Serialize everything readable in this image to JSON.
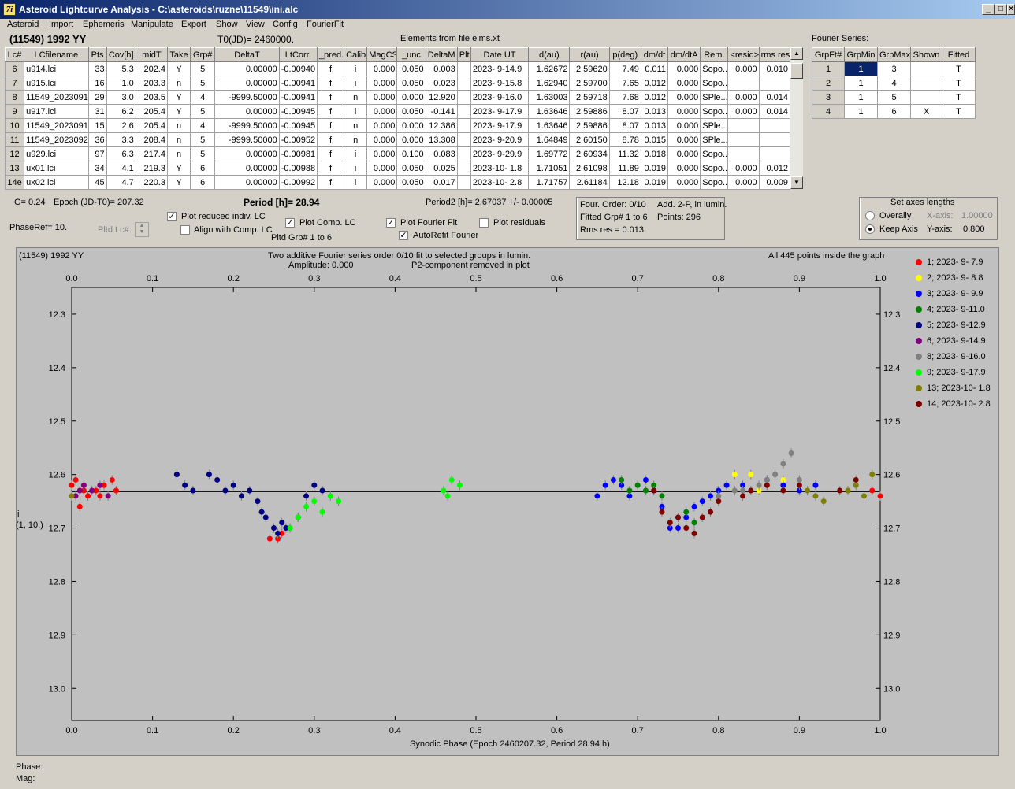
{
  "window": {
    "title": "Asteroid Lightcurve Analysis - C:\\asteroids\\ruzne\\11549\\ini.alc",
    "icon_text": "7i"
  },
  "menu": [
    "Asteroid",
    "Import",
    "Ephemeris",
    "Manipulate",
    "Export",
    "Show",
    "View",
    "Config",
    "FourierFit"
  ],
  "header": {
    "asteroid": "(11549) 1992 YY",
    "t0": "T0(JD)= 2460000.",
    "elements": "Elements from file elms.xt",
    "fourier_label": "Fourier Series:"
  },
  "lc_table": {
    "columns": [
      "Lc#",
      "LCfilename",
      "Pts",
      "Cov[h]",
      "midT",
      "Take",
      "Grp#",
      "DeltaT",
      "LtCorr.",
      "_pred.",
      "Calib.",
      "MagCS",
      "_unc",
      "DeltaM",
      "Plt",
      "Date UT",
      "d(au)",
      "r(au)",
      "p(deg)",
      "dm/dt",
      "dm/dtA",
      "Rem.",
      "<resid>",
      "rms res"
    ],
    "rows": [
      [
        "6",
        "u914.lci",
        "33",
        "5.3",
        "202.4",
        "Y",
        "5",
        "0.00000",
        "-0.00940",
        "f",
        "i",
        "0.000",
        "0.050",
        "0.003",
        "",
        "2023- 9-14.9",
        "1.62672",
        "2.59620",
        "7.49",
        "0.011",
        "0.000",
        "Sopo...",
        "0.000",
        "0.010"
      ],
      [
        "7",
        "u915.lci",
        "16",
        "1.0",
        "203.3",
        "n",
        "5",
        "0.00000",
        "-0.00941",
        "f",
        "i",
        "0.000",
        "0.050",
        "0.023",
        "",
        "2023- 9-15.8",
        "1.62940",
        "2.59700",
        "7.65",
        "0.012",
        "0.000",
        "Sopo...",
        "",
        ""
      ],
      [
        "8",
        "11549_2023091",
        "29",
        "3.0",
        "203.5",
        "Y",
        "4",
        "-9999.50000",
        "-0.00941",
        "f",
        "n",
        "0.000",
        "0.000",
        "12.920",
        "",
        "2023- 9-16.0",
        "1.63003",
        "2.59718",
        "7.68",
        "0.012",
        "0.000",
        "SPle...",
        "0.000",
        "0.014"
      ],
      [
        "9",
        "u917.lci",
        "31",
        "6.2",
        "205.4",
        "Y",
        "5",
        "0.00000",
        "-0.00945",
        "f",
        "i",
        "0.000",
        "0.050",
        "-0.141",
        "",
        "2023- 9-17.9",
        "1.63646",
        "2.59886",
        "8.07",
        "0.013",
        "0.000",
        "Sopo...",
        "0.000",
        "0.014"
      ],
      [
        "10",
        "11549_2023091",
        "15",
        "2.6",
        "205.4",
        "n",
        "4",
        "-9999.50000",
        "-0.00945",
        "f",
        "n",
        "0.000",
        "0.000",
        "12.386",
        "",
        "2023- 9-17.9",
        "1.63646",
        "2.59886",
        "8.07",
        "0.013",
        "0.000",
        "SPle...",
        "",
        ""
      ],
      [
        "11",
        "11549_2023092",
        "36",
        "3.3",
        "208.4",
        "n",
        "5",
        "-9999.50000",
        "-0.00952",
        "f",
        "n",
        "0.000",
        "0.000",
        "13.308",
        "",
        "2023- 9-20.9",
        "1.64849",
        "2.60150",
        "8.78",
        "0.015",
        "0.000",
        "SPle...",
        "",
        ""
      ],
      [
        "12",
        "u929.lci",
        "97",
        "6.3",
        "217.4",
        "n",
        "5",
        "0.00000",
        "-0.00981",
        "f",
        "i",
        "0.000",
        "0.100",
        "0.083",
        "",
        "2023- 9-29.9",
        "1.69772",
        "2.60934",
        "11.32",
        "0.018",
        "0.000",
        "Sopo...",
        "",
        ""
      ],
      [
        "13",
        "ux01.lci",
        "34",
        "4.1",
        "219.3",
        "Y",
        "6",
        "0.00000",
        "-0.00988",
        "f",
        "i",
        "0.000",
        "0.050",
        "0.025",
        "",
        "2023-10- 1.8",
        "1.71051",
        "2.61098",
        "11.89",
        "0.019",
        "0.000",
        "Sopo...",
        "0.000",
        "0.012"
      ],
      [
        "14e",
        "ux02.lci",
        "45",
        "4.7",
        "220.3",
        "Y",
        "6",
        "0.00000",
        "-0.00992",
        "f",
        "i",
        "0.000",
        "0.050",
        "0.017",
        "",
        "2023-10- 2.8",
        "1.71757",
        "2.61184",
        "12.18",
        "0.019",
        "0.000",
        "Sopo...",
        "0.000",
        "0.009"
      ]
    ]
  },
  "fourier_table": {
    "columns": [
      "GrpFt#",
      "GrpMin",
      "GrpMax",
      "Shown",
      "Fitted"
    ],
    "rows": [
      [
        "1",
        "1",
        "3",
        "",
        "T"
      ],
      [
        "2",
        "1",
        "4",
        "",
        "T"
      ],
      [
        "3",
        "1",
        "5",
        "",
        "T"
      ],
      [
        "4",
        "1",
        "6",
        "X",
        "T"
      ]
    ]
  },
  "params": {
    "g": "G= 0.24",
    "epoch": "Epoch (JD-T0)= 207.32",
    "period": "Period [h]= 28.94",
    "period2": "Period2 [h]= 2.67037 +/- 0.00005",
    "phaseref": "PhaseRef= 10.",
    "pltd_lc": "Pltd Lc#:",
    "pltd_grp": "Pltd Grp#  1   to   6"
  },
  "checkboxes": {
    "plot_reduced": {
      "label": "Plot reduced indiv. LC",
      "checked": true
    },
    "align_comp": {
      "label": "Align with Comp. LC",
      "checked": false
    },
    "plot_comp": {
      "label": "Plot Comp. LC",
      "checked": true
    },
    "plot_fourier": {
      "label": "Plot Fourier Fit",
      "checked": true
    },
    "plot_residuals": {
      "label": "Plot residuals",
      "checked": false
    },
    "autorefit": {
      "label": "AutoRefit Fourier",
      "checked": true
    }
  },
  "fit_info": {
    "order": "Four. Order:  0/10",
    "add": "Add. 2-P, in lumin.",
    "fitted": "Fitted Grp# 1 to 6",
    "points": "Points: 296",
    "rms": "Rms res     = 0.013"
  },
  "axes_box": {
    "title": "Set axes lengths",
    "overally": "Overally",
    "keep": "Keep Axis",
    "xlabel": "X-axis:",
    "xval": "1.00000",
    "ylabel": "Y-axis:",
    "yval": "0.800"
  },
  "plot": {
    "corner": "(11549) 1992 YY",
    "title1": "Two additive Fourier series order 0/10 fit to selected groups in lumin.",
    "title2": "Amplitude: 0.000",
    "title3": "P2-component removed in plot",
    "inside": "All 445 points inside the graph",
    "ylabel1": "i",
    "ylabel2": "(1, 10.)",
    "xlabel": "Synodic Phase (Epoch 2460207.32, Period 28.94 h)"
  },
  "status": {
    "phase": "Phase:",
    "mag": "Mag:"
  },
  "chart_data": {
    "type": "scatter",
    "xlim": [
      0.0,
      1.0
    ],
    "ylim": [
      12.25,
      13.06
    ],
    "y_inverted": true,
    "x_ticks": [
      "0.0",
      "0.1",
      "0.2",
      "0.3",
      "0.4",
      "0.5",
      "0.6",
      "0.7",
      "0.8",
      "0.9",
      "1.0"
    ],
    "y_ticks": [
      "12.3",
      "12.4",
      "12.5",
      "12.6",
      "12.7",
      "12.8",
      "12.9",
      "13.0"
    ],
    "fit_line_y": 12.632,
    "legend_placement": "right",
    "series": [
      {
        "name": "1; 2023- 9- 7.9",
        "color": "#ff0000",
        "points": [
          [
            0.0,
            12.62
          ],
          [
            0.01,
            12.66
          ],
          [
            0.015,
            12.63
          ],
          [
            0.02,
            12.64
          ],
          [
            0.03,
            12.63
          ],
          [
            0.04,
            12.62
          ],
          [
            0.05,
            12.61
          ],
          [
            0.055,
            12.63
          ],
          [
            0.005,
            12.61
          ],
          [
            0.035,
            12.64
          ],
          [
            0.245,
            12.72
          ],
          [
            0.255,
            12.72
          ],
          [
            0.26,
            12.71
          ],
          [
            1.0,
            12.64
          ],
          [
            0.99,
            12.63
          ]
        ]
      },
      {
        "name": "2; 2023- 9- 8.8",
        "color": "#ffff00",
        "points": [
          [
            0.82,
            12.6
          ],
          [
            0.84,
            12.6
          ],
          [
            0.86,
            12.62
          ],
          [
            0.88,
            12.61
          ],
          [
            0.9,
            12.62
          ],
          [
            0.85,
            12.63
          ]
        ]
      },
      {
        "name": "3; 2023- 9- 9.9",
        "color": "#0000ff",
        "points": [
          [
            0.65,
            12.64
          ],
          [
            0.66,
            12.62
          ],
          [
            0.67,
            12.61
          ],
          [
            0.68,
            12.62
          ],
          [
            0.69,
            12.64
          ],
          [
            0.71,
            12.61
          ],
          [
            0.72,
            12.63
          ],
          [
            0.73,
            12.66
          ],
          [
            0.74,
            12.7
          ],
          [
            0.75,
            12.7
          ],
          [
            0.76,
            12.68
          ],
          [
            0.77,
            12.66
          ],
          [
            0.78,
            12.65
          ],
          [
            0.79,
            12.64
          ],
          [
            0.8,
            12.63
          ],
          [
            0.81,
            12.62
          ],
          [
            0.83,
            12.62
          ],
          [
            0.86,
            12.61
          ],
          [
            0.88,
            12.62
          ],
          [
            0.9,
            12.63
          ],
          [
            0.92,
            12.62
          ]
        ]
      },
      {
        "name": "4; 2023- 9-11.0",
        "color": "#008000",
        "points": [
          [
            0.68,
            12.61
          ],
          [
            0.69,
            12.63
          ],
          [
            0.7,
            12.62
          ],
          [
            0.71,
            12.63
          ],
          [
            0.72,
            12.62
          ],
          [
            0.73,
            12.64
          ],
          [
            0.75,
            12.68
          ],
          [
            0.76,
            12.67
          ],
          [
            0.77,
            12.69
          ]
        ]
      },
      {
        "name": "5; 2023- 9-12.9",
        "color": "#000080",
        "points": [
          [
            0.13,
            12.6
          ],
          [
            0.14,
            12.62
          ],
          [
            0.15,
            12.63
          ],
          [
            0.17,
            12.6
          ],
          [
            0.18,
            12.61
          ],
          [
            0.19,
            12.63
          ],
          [
            0.2,
            12.62
          ],
          [
            0.21,
            12.64
          ],
          [
            0.22,
            12.63
          ],
          [
            0.23,
            12.65
          ],
          [
            0.24,
            12.68
          ],
          [
            0.25,
            12.7
          ],
          [
            0.26,
            12.69
          ],
          [
            0.27,
            12.7
          ],
          [
            0.28,
            12.68
          ],
          [
            0.29,
            12.64
          ],
          [
            0.3,
            12.62
          ],
          [
            0.31,
            12.63
          ],
          [
            0.235,
            12.67
          ],
          [
            0.255,
            12.71
          ],
          [
            0.265,
            12.7
          ]
        ]
      },
      {
        "name": "6; 2023- 9-14.9",
        "color": "#800080",
        "points": [
          [
            0.005,
            12.64
          ],
          [
            0.015,
            12.62
          ],
          [
            0.025,
            12.63
          ],
          [
            0.035,
            12.62
          ],
          [
            0.045,
            12.64
          ],
          [
            0.01,
            12.63
          ]
        ]
      },
      {
        "name": "8; 2023- 9-16.0",
        "color": "#808080",
        "points": [
          [
            0.8,
            12.64
          ],
          [
            0.83,
            12.63
          ],
          [
            0.85,
            12.62
          ],
          [
            0.87,
            12.6
          ],
          [
            0.88,
            12.58
          ],
          [
            0.89,
            12.56
          ],
          [
            0.9,
            12.61
          ],
          [
            0.82,
            12.63
          ],
          [
            0.86,
            12.61
          ]
        ]
      },
      {
        "name": "9; 2023- 9-17.9",
        "color": "#00ff00",
        "points": [
          [
            0.27,
            12.7
          ],
          [
            0.28,
            12.68
          ],
          [
            0.29,
            12.66
          ],
          [
            0.3,
            12.65
          ],
          [
            0.31,
            12.67
          ],
          [
            0.32,
            12.64
          ],
          [
            0.33,
            12.65
          ],
          [
            0.46,
            12.63
          ],
          [
            0.47,
            12.61
          ],
          [
            0.48,
            12.62
          ],
          [
            0.465,
            12.64
          ]
        ]
      },
      {
        "name": "13; 2023-10- 1.8",
        "color": "#808000",
        "points": [
          [
            0.91,
            12.63
          ],
          [
            0.92,
            12.64
          ],
          [
            0.93,
            12.65
          ],
          [
            0.96,
            12.63
          ],
          [
            0.97,
            12.62
          ],
          [
            0.98,
            12.64
          ],
          [
            0.99,
            12.6
          ],
          [
            0.0,
            12.64
          ]
        ]
      },
      {
        "name": "14; 2023-10- 2.8",
        "color": "#800000",
        "points": [
          [
            0.72,
            12.63
          ],
          [
            0.73,
            12.67
          ],
          [
            0.74,
            12.69
          ],
          [
            0.75,
            12.68
          ],
          [
            0.76,
            12.7
          ],
          [
            0.77,
            12.71
          ],
          [
            0.78,
            12.68
          ],
          [
            0.79,
            12.67
          ],
          [
            0.8,
            12.65
          ],
          [
            0.83,
            12.64
          ],
          [
            0.84,
            12.63
          ],
          [
            0.86,
            12.62
          ],
          [
            0.88,
            12.63
          ],
          [
            0.9,
            12.62
          ],
          [
            0.95,
            12.63
          ],
          [
            0.97,
            12.61
          ]
        ]
      }
    ]
  }
}
